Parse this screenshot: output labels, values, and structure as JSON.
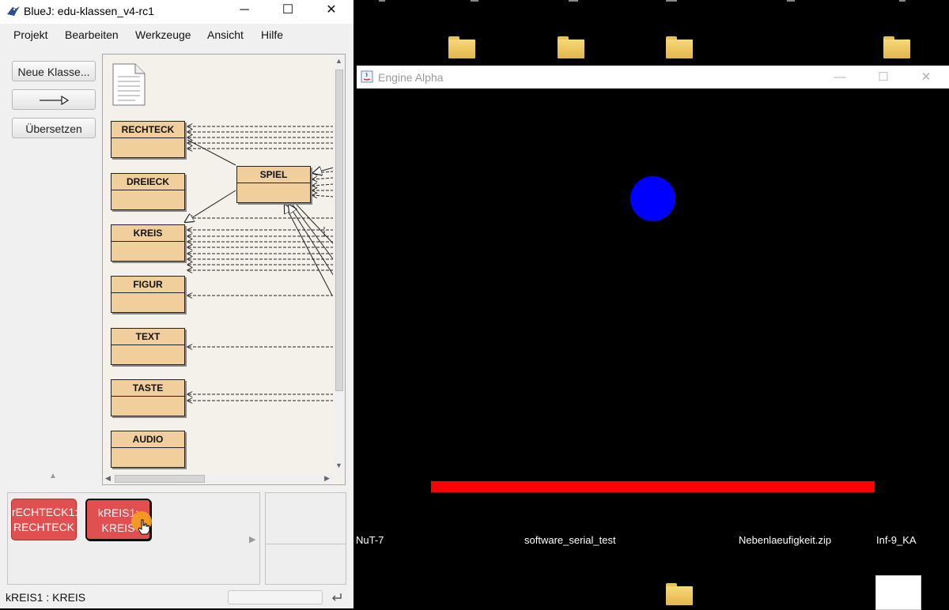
{
  "bluej": {
    "title": "BlueJ:  edu-klassen_v4-rc1",
    "controls": {
      "minimize": "─",
      "maximize": "☐",
      "close": "✕"
    },
    "menu": [
      "Projekt",
      "Bearbeiten",
      "Werkzeuge",
      "Ansicht",
      "Hilfe"
    ],
    "buttons": {
      "new_class": "Neue Klasse...",
      "arrow": "—▷",
      "compile": "Übersetzen"
    },
    "classes": [
      "RECHTECK",
      "DREIECK",
      "KREIS",
      "FIGUR",
      "TEXT",
      "TASTE",
      "AUDIO",
      "SPIEL"
    ],
    "objects": [
      {
        "name": "rECHTECK1:",
        "type": "RECHTECK"
      },
      {
        "name": "kREIS1:",
        "type": "KREIS"
      }
    ],
    "status": "kREIS1 : KREIS",
    "colors": {
      "class_fill": "#f1cf9c",
      "object_fill": "#e05050"
    }
  },
  "engine_window": {
    "title": "Engine Alpha",
    "controls": {
      "minimize": "—",
      "maximize": "☐",
      "close": "✕"
    },
    "colors": {
      "background": "#000000",
      "ball": "#0000ff",
      "paddle": "#ff0000"
    }
  },
  "desktop": {
    "labels": [
      "NuT-7",
      "software_serial_test",
      "Nebenlaeufigkeit.zip",
      "Inf-9_KA"
    ]
  }
}
